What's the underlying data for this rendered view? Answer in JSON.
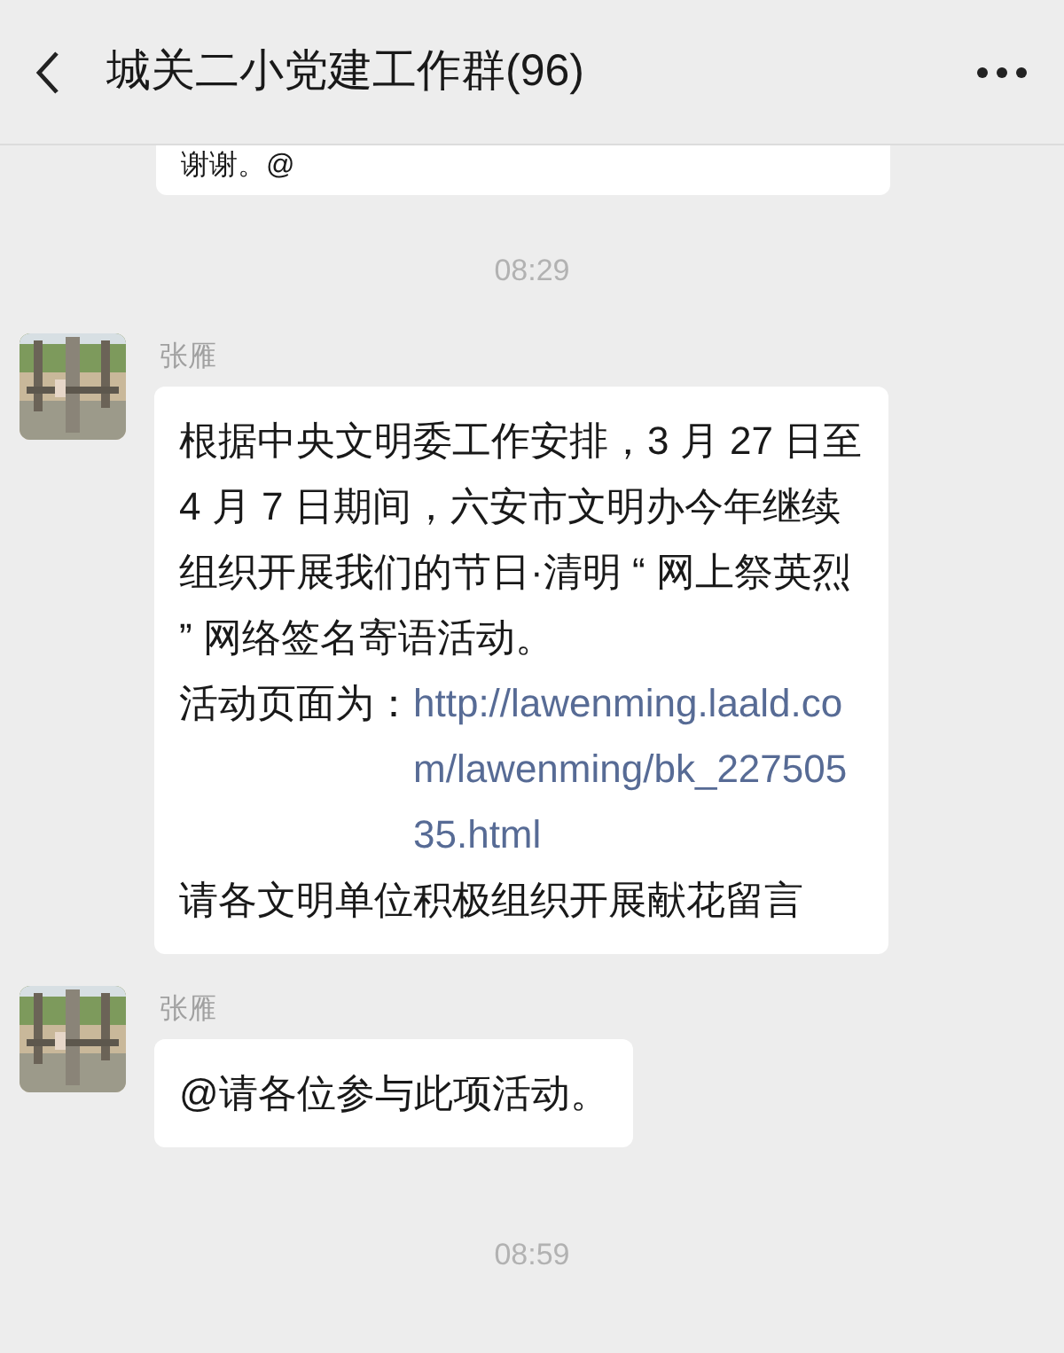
{
  "header": {
    "title": "城关二小党建工作群(96)"
  },
  "messages": [
    {
      "kind": "bubble_cut",
      "paragraphs": [
        [
          {
            "kind": "text",
            "text": "谢谢。@"
          }
        ]
      ]
    },
    {
      "kind": "time",
      "text": "08:29"
    },
    {
      "kind": "bubble",
      "sender": "张雁",
      "avatar": {
        "kind": "picture"
      },
      "paragraphs": [
        [
          {
            "kind": "text",
            "text": "根据中央文明委工作安排，3 月 27 日至 4 月 7 日期间，六安市文明办今年继续组织开展我们的节日·清明 “ 网上祭英烈 ” 网络签名寄语活动。"
          }
        ],
        [
          {
            "kind": "text",
            "text": "活动页面为："
          },
          {
            "kind": "link",
            "text": "http://lawenming.laald.com/lawenming/bk_22750535.html"
          }
        ],
        [
          {
            "kind": "text",
            "text": "请各文明单位积极组织开展献花留言"
          }
        ]
      ]
    },
    {
      "kind": "bubble",
      "sender": "张雁",
      "avatar": {
        "kind": "picture"
      },
      "paragraphs": [
        [
          {
            "kind": "text",
            "text": "@请各位参与此项活动。"
          }
        ]
      ]
    },
    {
      "kind": "time",
      "text": "08:59"
    }
  ]
}
